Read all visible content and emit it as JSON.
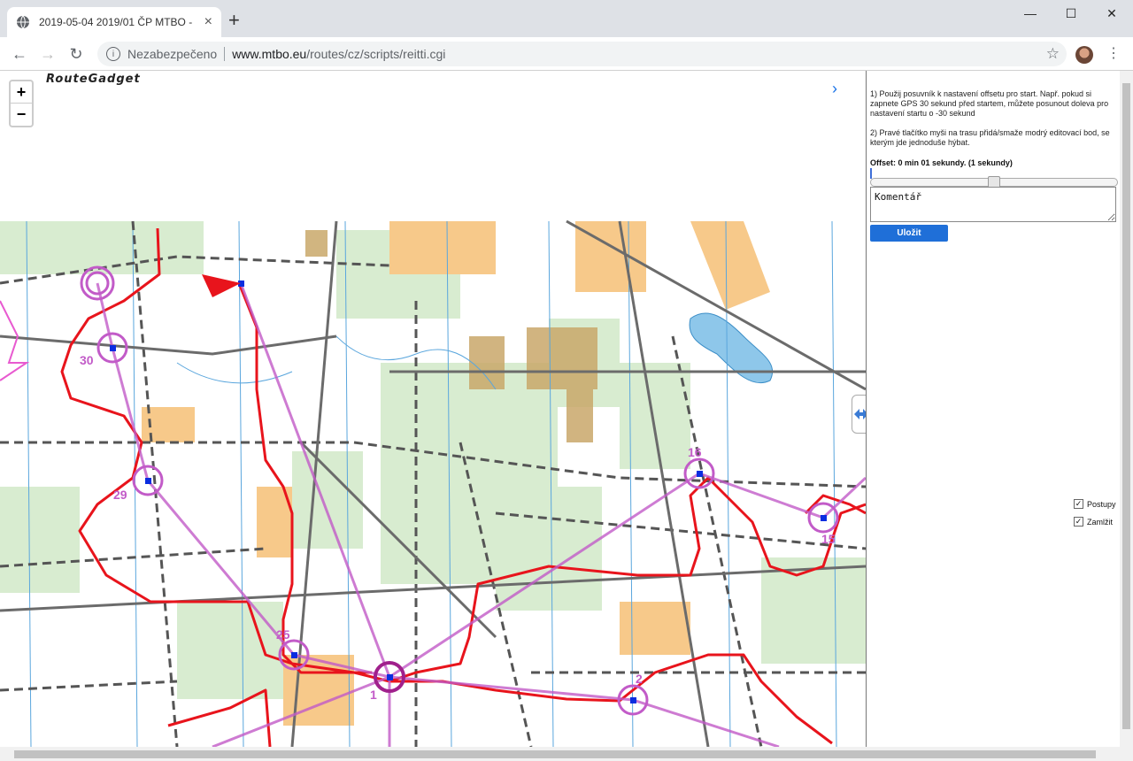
{
  "browser": {
    "tab_title": "2019-05-04 2019/01 ČP MTBO -",
    "tab_icon": "globe-icon",
    "tab_close": "×",
    "new_tab": "+",
    "minimize": "—",
    "maximize": "☐",
    "close": "✕",
    "back": "←",
    "forward": "→",
    "reload": "↻",
    "security_label": "Nezabezpečeno",
    "url_host": "www.mtbo.eu",
    "url_path": "/routes/cz/scripts/reitti.cgi",
    "bookmark": "☆",
    "menu": "⋮"
  },
  "map": {
    "logo": "RouteGadget",
    "zoom_in": "+",
    "zoom_out": "−",
    "panel_chevron": "›",
    "control_labels": [
      "30",
      "29",
      "25",
      "16",
      "15",
      "2",
      "1"
    ],
    "colors": {
      "route": "#e8141c",
      "course": "#c25bc8",
      "track": "#ffffff",
      "veg": "#d8ecd0",
      "open": "#f7c98a",
      "water": "#8ec7ea"
    }
  },
  "panel": {
    "instruction_1": "1) Použij posuvník k nastavení offsetu pro start. Např. pokud si zapnete GPS 30 sekund před startem, můžete posunout doleva pro nastavení startu o -30 sekund",
    "instruction_2": "2) Pravé tlačítko myši na trasu přidá/smaže modrý editovací bod, se kterým jde jednoduše hýbat.",
    "offset_label": "Offset: 0 min 01 sekundy. (1 sekundy)",
    "offset_seconds": 1,
    "comment_value": "Komentář",
    "save_label": "Uložit",
    "checkbox_legs": "Postupy",
    "checkbox_legs_checked": true,
    "checkbox_lock": "Zamlžit",
    "checkbox_lock_checked": true
  }
}
